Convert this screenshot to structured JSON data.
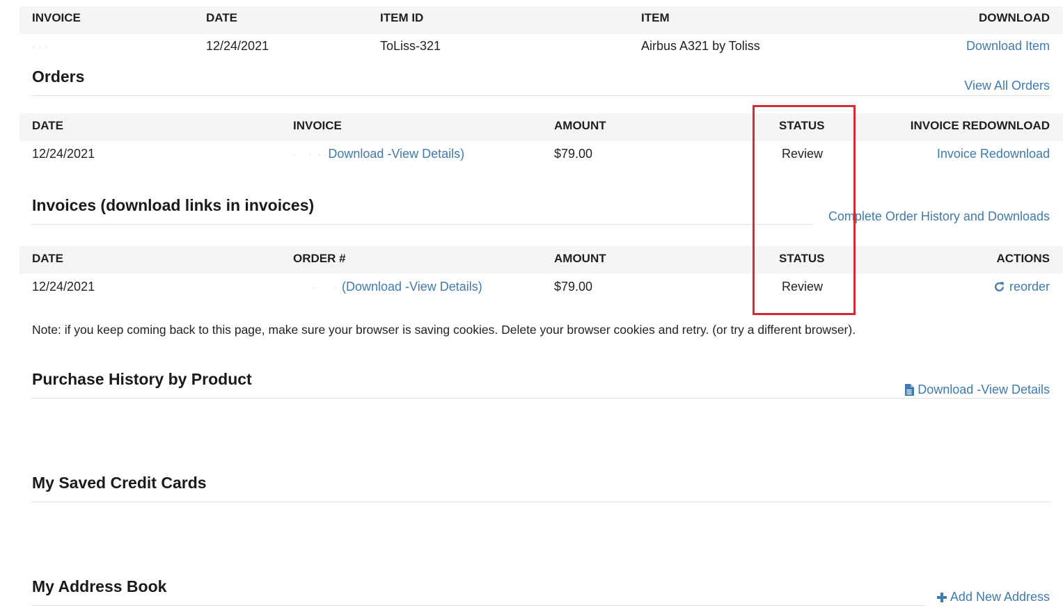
{
  "items_table": {
    "headers": [
      "INVOICE",
      "DATE",
      "ITEM ID",
      "ITEM",
      "DOWNLOAD"
    ],
    "row": {
      "invoice": "",
      "date": "12/24/2021",
      "item_id": "ToLiss-321",
      "item": "Airbus A321 by Toliss",
      "download": "Download Item"
    }
  },
  "orders": {
    "title": "Orders",
    "view_all": "View All Orders",
    "headers": [
      "DATE",
      "INVOICE",
      "AMOUNT",
      "STATUS",
      "INVOICE REDOWNLOAD"
    ],
    "row": {
      "date": "12/24/2021",
      "invoice_links": "Download -View Details)",
      "amount": "$79.00",
      "status": "Review",
      "redownload": "Invoice Redownload"
    }
  },
  "invoices": {
    "title": "Invoices (download links in invoices)",
    "history_link": "Complete Order History and Downloads",
    "headers": [
      "DATE",
      "ORDER #",
      "AMOUNT",
      "STATUS",
      "ACTIONS"
    ],
    "row": {
      "date": "12/24/2021",
      "order_links": "(Download -View Details)",
      "amount": "$79.00",
      "status": "Review",
      "action": "reorder",
      "action_icon": "refresh-icon"
    }
  },
  "note": "Note: if you keep coming back to this page, make sure your browser is saving cookies. Delete your browser cookies and retry. (or try a different browser).",
  "purchase_history": {
    "title": "Purchase History by Product",
    "link": "Download -View Details",
    "link_icon": "file-icon"
  },
  "saved_cards": {
    "title": "My Saved Credit Cards"
  },
  "address_book": {
    "title": "My Address Book",
    "add_link": "Add New Address",
    "add_icon": "plus-icon"
  },
  "colors": {
    "link": "#3f7ab0",
    "highlight_box": "#d62b32",
    "header_bg": "#f5f5f5"
  }
}
